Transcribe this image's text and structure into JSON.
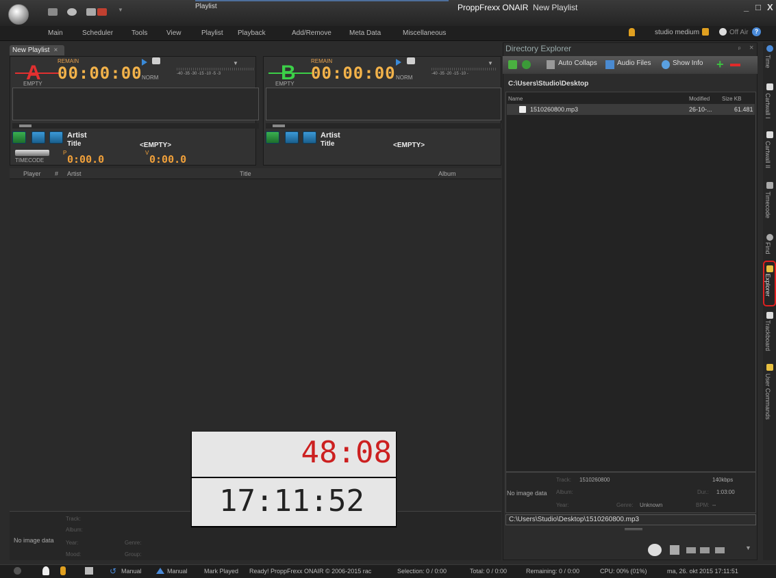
{
  "titlebar": {
    "tab_label": "Playlist",
    "app_name": "ProppFrexx ONAIR",
    "doc_name": "New Playlist",
    "window_controls": [
      "_",
      "□",
      "X"
    ]
  },
  "menu": {
    "items": [
      "Main",
      "Scheduler",
      "Tools",
      "View",
      "Playlist",
      "Playback",
      "Add/Remove",
      "Meta Data",
      "Miscellaneous"
    ],
    "user_label": "studio medium",
    "offair_label": "Off Air"
  },
  "playlist_tab": {
    "label": "New Playlist"
  },
  "player_a": {
    "letter": "A",
    "letter_color": "#e23030",
    "remain_label": "REMAIN",
    "time": "00:00:00",
    "status": "EMPTY",
    "mode": "NORM",
    "meter_scale": "-40  -35 -30  -15  -10  -5 -3",
    "artist_label": "Artist",
    "title_label": "Title",
    "title_value": "<EMPTY>",
    "timecode_label": "TIMECODE",
    "elapsed_prefix": "P",
    "elapsed": "0:00.0",
    "remain_prefix": "V",
    "remain": "0:00.0"
  },
  "player_b": {
    "letter": "B",
    "letter_color": "#3cd048",
    "remain_label": "REMAIN",
    "time": "00:00:00",
    "status": "EMPTY",
    "mode": "NORM",
    "meter_scale": "-40  -35 -20  -15  -10  -",
    "artist_label": "Artist",
    "title_label": "Title",
    "title_value": "<EMPTY>"
  },
  "playlist_columns": [
    "Player",
    "#",
    "Artist",
    "Title",
    "Album"
  ],
  "clock": {
    "countdown": "48:08",
    "time": "17:11:52"
  },
  "track_info": {
    "no_image": "No image data",
    "labels": [
      "Track:",
      "Album:",
      "Year:",
      "Genre:",
      "Mood:",
      "Group:"
    ]
  },
  "directory": {
    "title": "Directory Explorer",
    "toolbar": {
      "auto_collapse": "Auto Collaps",
      "audio_files": "Audio Files",
      "show_info": "Show Info"
    },
    "path": "C:\\Users\\Studio\\Desktop",
    "columns": [
      "Name",
      "Modified",
      "Size KB"
    ],
    "files": [
      {
        "name": "1510260800.mp3",
        "modified": "26-10-...",
        "size": "61.481"
      }
    ],
    "info": {
      "no_image": "No image data",
      "track_label": "Track:",
      "track": "1510260800",
      "bitrate": "140kbps",
      "album_label": "Album:",
      "dur_label": "Dur.:",
      "duration": "1:03:00",
      "year_label": "Year:",
      "genre_label": "Genre:",
      "genre": "Unknown",
      "bpm_label": "BPM:",
      "bpm": "--"
    },
    "fullpath": "C:\\Users\\Studio\\Desktop\\1510260800.mp3"
  },
  "side_tabs": [
    "Time",
    "Cartwall I",
    "Cartwall II",
    "Timecode",
    "Find",
    "Explorer",
    "Trackboard",
    "User Commands"
  ],
  "statusbar": {
    "manual1": "Manual",
    "manual2": "Manual",
    "mark_played": "Mark Played",
    "ready": "Ready! ProppFrexx ONAIR © 2006-2015 rac",
    "selection": "Selection: 0 / 0:00",
    "total": "Total: 0 / 0:00",
    "remaining": "Remaining: 0 / 0:00",
    "cpu": "CPU: 00% (01%)",
    "datetime": "ma, 26. okt 2015 17:11:51"
  }
}
